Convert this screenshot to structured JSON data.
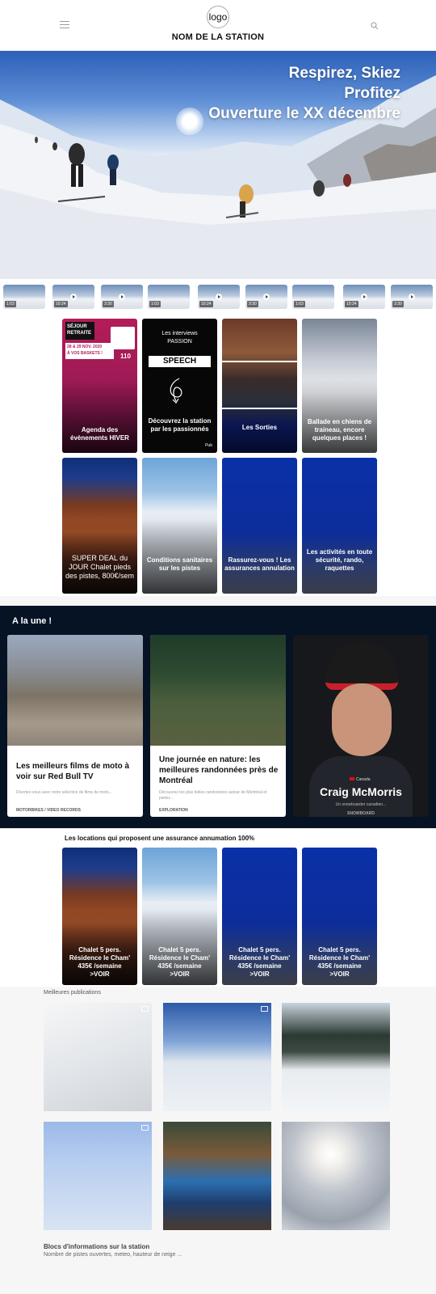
{
  "header": {
    "logo_text": "logo",
    "station_name": "NOM DE LA STATION",
    "menu_icon": "hamburger-menu-icon",
    "search_icon": "search-icon"
  },
  "hero": {
    "line1": "Respirez, Skiez",
    "line2": "Profitez",
    "line3": "Ouverture le XX décembre"
  },
  "videos": [
    {
      "duration": "1:03"
    },
    {
      "duration": "10:24"
    },
    {
      "duration": "3:30"
    },
    {
      "duration": "1:03"
    },
    {
      "duration": "10:24"
    },
    {
      "duration": "3:30"
    },
    {
      "duration": "1:03"
    },
    {
      "duration": "10:24"
    },
    {
      "duration": "3:30"
    }
  ],
  "promo": {
    "badge_line1": "SÉJOUR",
    "badge_line2": "RETRAITE",
    "dates": "28 & 29 NOV. 2020",
    "tagline": "À VOS BASKETS !",
    "price": "110"
  },
  "interviews": {
    "heading_line1": "Les interviews",
    "heading_line2": "PASSION",
    "label": "SPEECH",
    "pub": "Pub"
  },
  "tiles": [
    {
      "caption": "Agenda des évènements HIVER"
    },
    {
      "caption": "Découvrez la station par les passionnés"
    },
    {
      "caption": "Les Sorties"
    },
    {
      "caption": "Ballade en chiens de traineau, encore quelques places !"
    },
    {
      "caption": "SUPER DEAL du JOUR Chalet pieds des pistes, 800€/sem"
    },
    {
      "caption": "Conditions sanitaires sur les pistes"
    },
    {
      "caption": "Rassurez-vous ! Les assurances annulation"
    },
    {
      "caption": "Les activités en toute sécurité, rando, raquettes"
    }
  ],
  "a_la_une": {
    "title": "A la une !",
    "cards": [
      {
        "title": "Les meilleurs films de moto à voir sur Red Bull TV",
        "desc": "Divertez-vous avec notre sélection de films de moto...",
        "tag": "MOTORBIKES / VIDEO RECORDS"
      },
      {
        "title": "Une journée en nature: les meilleures randonnées près de Montréal",
        "desc": "Découvrez les plus belles randonnées autour de Montréal et partez...",
        "tag": "EXPLORATION"
      },
      {
        "title": "Craig McMorris",
        "desc": "Un snowboarder canadien...",
        "tag": "SNOWBOARD",
        "country": "Canada"
      }
    ]
  },
  "locations": {
    "title": "Les locations qui proposent une assurance annumation 100%",
    "items": [
      {
        "line1": "Chalet 5 pers.",
        "line2": "Résidence le Cham'",
        "line3": "435€ /semaine",
        "line4": ">VOIR"
      },
      {
        "line1": "Chalet 5 pers.",
        "line2": "Résidence le Cham'",
        "line3": "435€ /semaine",
        "line4": ">VOIR"
      },
      {
        "line1": "Chalet 5 pers.",
        "line2": "Résidence le Cham'",
        "line3": "435€ /semaine",
        "line4": ">VOIR"
      },
      {
        "line1": "Chalet 5 pers.",
        "line2": "Résidence le Cham'",
        "line3": "435€ /semaine",
        "line4": ">VOIR"
      }
    ]
  },
  "publications": {
    "title": "Meilleures publications"
  },
  "infos": {
    "title": "Blocs d'informations sur la station",
    "subtitle": "Nombre de pistes ouvertes, meteo, hauteur de neige ..."
  },
  "colors": {
    "blue_tile_top": "#0a30a8",
    "blue_tile_bottom": "#3a4f7a",
    "dark_band": "#061324",
    "promo_pink": "#b01f58"
  }
}
